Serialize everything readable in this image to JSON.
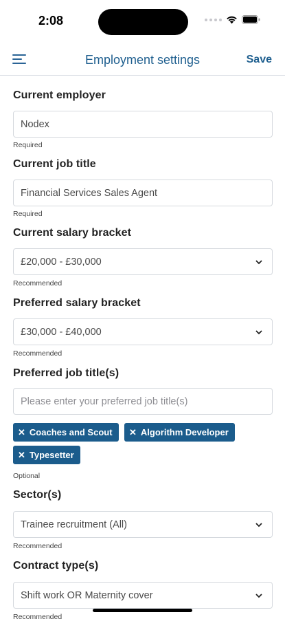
{
  "status_bar": {
    "time": "2:08"
  },
  "nav": {
    "title": "Employment settings",
    "save_label": "Save"
  },
  "fields": {
    "current_employer": {
      "label": "Current employer",
      "value": "Nodex",
      "hint": "Required"
    },
    "current_job_title": {
      "label": "Current job title",
      "value": "Financial Services Sales Agent",
      "hint": "Required"
    },
    "current_salary": {
      "label": "Current salary bracket",
      "value": "£20,000 - £30,000",
      "hint": "Recommended"
    },
    "preferred_salary": {
      "label": "Preferred salary bracket",
      "value": "£30,000 - £40,000",
      "hint": "Recommended"
    },
    "preferred_job_titles": {
      "label": "Preferred job title(s)",
      "placeholder": "Please enter your preferred job title(s)",
      "chips": [
        "Coaches and Scout",
        "Algorithm Developer",
        "Typesetter"
      ],
      "hint": "Optional"
    },
    "sectors": {
      "label": "Sector(s)",
      "value": "Trainee recruitment (All)",
      "hint": "Recommended"
    },
    "contract_types": {
      "label": "Contract type(s)",
      "value": "Shift work OR Maternity cover",
      "hint": "Recommended"
    }
  },
  "colors": {
    "accent": "#1f5f8f",
    "chip_bg": "#1b5c8c",
    "border": "#d5d9de"
  },
  "icons": {
    "menu": "hamburger-icon",
    "chevron": "chevron-down-icon",
    "remove": "close-icon"
  }
}
